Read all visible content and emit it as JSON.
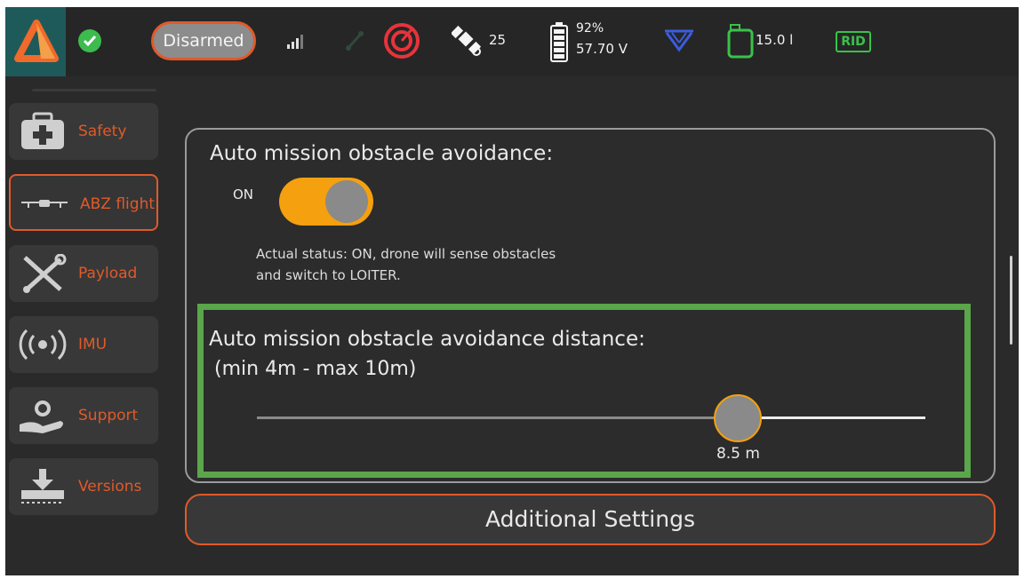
{
  "topbar": {
    "arm_state": "Disarmed",
    "satellites": "25",
    "battery_percent": "92%",
    "battery_voltage": "57.70 V",
    "tank_volume": "15.0 l",
    "rid_label": "RID",
    "icons": [
      "app-logo-icon",
      "status-ok-icon",
      "signal-bars-icon",
      "link-icon",
      "target-icon",
      "satellite-icon",
      "battery-icon",
      "sprayer-icon",
      "tank-icon"
    ]
  },
  "sidebar": {
    "items": [
      {
        "label": "Safety",
        "icon": "first-aid-kit-icon",
        "active": false
      },
      {
        "label": "ABZ flight",
        "icon": "drone-icon",
        "active": true
      },
      {
        "label": "Payload",
        "icon": "tools-icon",
        "active": false
      },
      {
        "label": "IMU",
        "icon": "broadcast-icon",
        "active": false
      },
      {
        "label": "Support",
        "icon": "support-icon",
        "active": false
      },
      {
        "label": "Versions",
        "icon": "download-icon",
        "active": false
      }
    ]
  },
  "main": {
    "avoidance_title": "Auto mission obstacle avoidance:",
    "toggle_label": "ON",
    "toggle_on": true,
    "status_line1": "Actual status: ON, drone will sense obstacles",
    "status_line2": "and switch to LOITER.",
    "distance_title": "Auto mission obstacle avoidance distance:",
    "distance_range": "(min 4m - max 10m)",
    "distance_value": "8.5 m",
    "distance_fraction": 0.72,
    "additional_settings_label": "Additional Settings"
  },
  "colors": {
    "accent": "#e05a2a",
    "toggle_on": "#f5a00e",
    "highlight": "#5aa64a",
    "ok": "#3dbb4e"
  }
}
